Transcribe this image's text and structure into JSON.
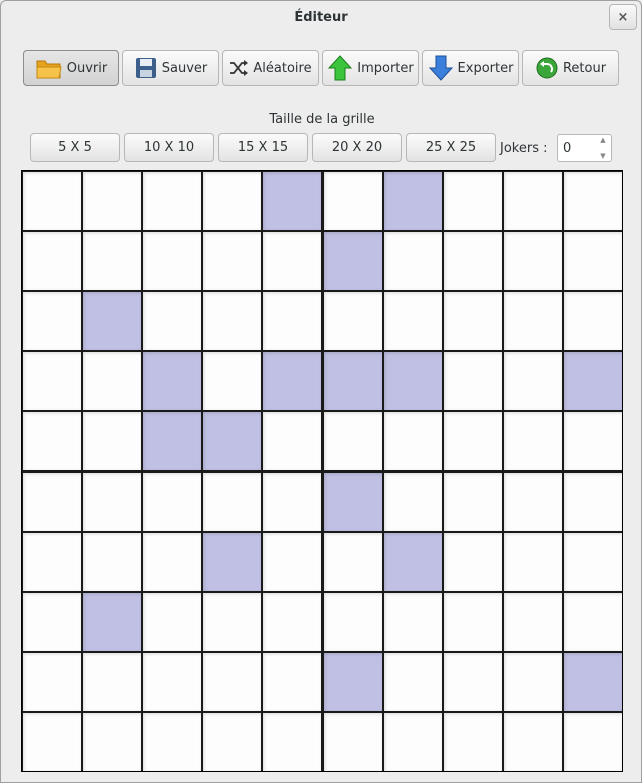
{
  "window": {
    "title": "Éditeur",
    "close_glyph": "×"
  },
  "toolbar": {
    "buttons": [
      {
        "label": "Ouvrir",
        "icon": "folder-icon"
      },
      {
        "label": "Sauver",
        "icon": "floppy-icon"
      },
      {
        "label": "Aléatoire",
        "icon": "shuffle-icon"
      },
      {
        "label": "Importer",
        "icon": "arrow-up-icon"
      },
      {
        "label": "Exporter",
        "icon": "arrow-down-icon"
      },
      {
        "label": "Retour",
        "icon": "undo-icon"
      }
    ]
  },
  "grid_size": {
    "label": "Taille de la grille",
    "options": [
      "5 X 5",
      "10 X 10",
      "15 X 15",
      "20 X 20",
      "25 X 25"
    ]
  },
  "jokers": {
    "label": "Jokers :",
    "value": "0"
  },
  "grid": {
    "rows": 10,
    "cols": 10,
    "filled_color": "#bfc0e3",
    "cells": [
      [
        0,
        0,
        0,
        0,
        1,
        0,
        1,
        0,
        0,
        0
      ],
      [
        0,
        0,
        0,
        0,
        0,
        1,
        0,
        0,
        0,
        0
      ],
      [
        0,
        1,
        0,
        0,
        0,
        0,
        0,
        0,
        0,
        0
      ],
      [
        0,
        0,
        1,
        0,
        1,
        1,
        1,
        0,
        0,
        1
      ],
      [
        0,
        0,
        1,
        1,
        0,
        0,
        0,
        0,
        0,
        0
      ],
      [
        0,
        0,
        0,
        0,
        0,
        1,
        0,
        0,
        0,
        0
      ],
      [
        0,
        0,
        0,
        1,
        0,
        0,
        1,
        0,
        0,
        0
      ],
      [
        0,
        1,
        0,
        0,
        0,
        0,
        0,
        0,
        0,
        0
      ],
      [
        0,
        0,
        0,
        0,
        0,
        1,
        0,
        0,
        0,
        1
      ],
      [
        0,
        0,
        0,
        0,
        0,
        0,
        0,
        0,
        0,
        0
      ]
    ]
  }
}
